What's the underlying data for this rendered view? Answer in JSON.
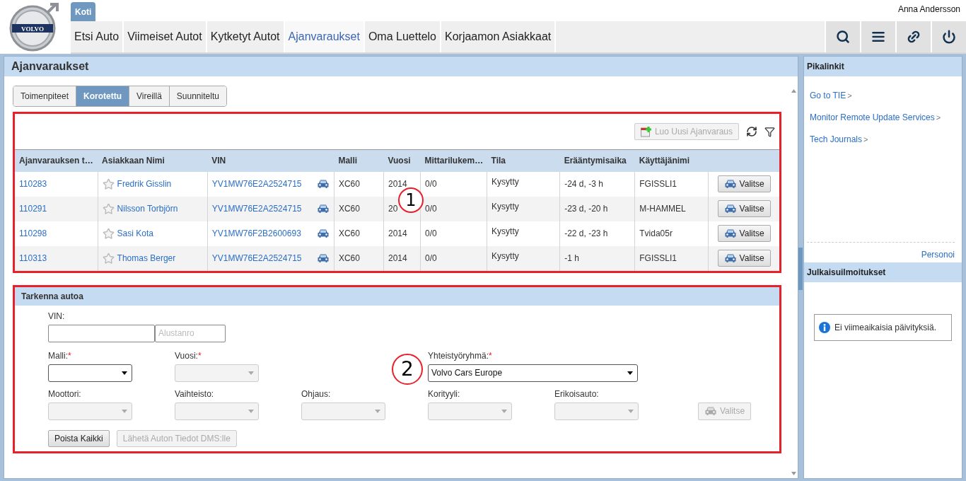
{
  "header": {
    "logo": "VOLVO",
    "home_tab": {
      "label": "Koti",
      "selected": true
    },
    "user": "Anna Andersson",
    "nav": [
      {
        "label": "Etsi Auto",
        "selected": false
      },
      {
        "label": "Viimeiset Autot",
        "selected": false
      },
      {
        "label": "Kytketyt Autot",
        "selected": false
      },
      {
        "label": "Ajanvaraukset",
        "selected": true
      },
      {
        "label": "Oma Luettelo",
        "selected": false
      },
      {
        "label": "Korjaamon Asiakkaat",
        "selected": false
      }
    ]
  },
  "page_title": "Ajanvaraukset",
  "filter_tabs": [
    {
      "label": "Toimenpiteet",
      "selected": false
    },
    {
      "label": "Korotettu",
      "selected": true
    },
    {
      "label": "Vireillä",
      "selected": false
    },
    {
      "label": "Suunniteltu",
      "selected": false
    }
  ],
  "bookings": {
    "callout": "1",
    "new_button": {
      "label": "Luo Uusi Ajanvaraus",
      "disabled": true
    },
    "columns": [
      "Ajanvarauksen t…",
      "Asiakkaan Nimi",
      "VIN",
      "Malli",
      "Vuosi",
      "Mittarilukem…",
      "Tila",
      "Erääntymisaika",
      "Käyttäjänimi"
    ],
    "rows": [
      {
        "id": "110283",
        "favorite": false,
        "name": "Fredrik Gisslin",
        "vin": "YV1MW76E2A2524715",
        "model": "XC60",
        "year": "2014",
        "mileage": "0/0",
        "status": "Kysytty",
        "due": "-24 d, -3 h",
        "user": "FGISSLI1",
        "action": "Valitse"
      },
      {
        "id": "110291",
        "favorite": false,
        "name": "Nilsson Torbjörn",
        "vin": "YV1MW76E2A2524715",
        "model": "XC60",
        "year": "20",
        "mileage": "0/0",
        "status": "Kysytty",
        "due": "-23 d, -20 h",
        "user": "M-HAMMEL",
        "action": "Valitse"
      },
      {
        "id": "110298",
        "favorite": false,
        "name": "Sasi Kota",
        "vin": "YV1MW76F2B2600693",
        "model": "XC60",
        "year": "2014",
        "mileage": "0/0",
        "status": "Kysytty",
        "due": "-22 d, -23 h",
        "user": "Tvida05r",
        "action": "Valitse"
      },
      {
        "id": "110313",
        "favorite": false,
        "name": "Thomas Berger",
        "vin": "YV1MW76E2A2524715",
        "model": "XC60",
        "year": "2014",
        "mileage": "0/0",
        "status": "Kysytty",
        "due": "-1 h",
        "user": "FGISSLI1",
        "action": "Valitse"
      }
    ]
  },
  "refine": {
    "callout": "2",
    "title": "Tarkenna autoa",
    "vin_label": "VIN:",
    "chassis_placeholder": "Alustanro",
    "fields": [
      {
        "label": "Malli:",
        "required_mark": "*",
        "disabled": false
      },
      {
        "label": "Vuosi:",
        "required_mark": "*",
        "disabled": true
      },
      {
        "kind": "spacer"
      },
      {
        "label": "Yhteistyöryhmä:",
        "required_mark": "*",
        "disabled": false,
        "value": "Volvo Cars Europe",
        "kind": "wide"
      },
      {
        "label": "Moottori:",
        "disabled": true
      },
      {
        "label": "Vaihteisto:",
        "disabled": true
      },
      {
        "label": "Ohjaus:",
        "disabled": true
      },
      {
        "label": "Korityyli:",
        "disabled": true
      },
      {
        "label": "Erikoisauto:",
        "disabled": true
      }
    ],
    "select_button": {
      "label": "Valitse",
      "disabled": true
    },
    "buttons": [
      {
        "label": "Poista Kaikki",
        "disabled": false
      },
      {
        "label": "Lähetä Auton Tiedot DMS:lle",
        "disabled": true
      }
    ]
  },
  "sidebar": {
    "title": "Pikalinkit",
    "links": [
      {
        "label": "Go to TIE",
        "arrow": ">"
      },
      {
        "label": "Monitor Remote Update Services",
        "arrow": ">"
      },
      {
        "label": "Tech Journals",
        "arrow": ">"
      }
    ],
    "personalize": "Personoi",
    "notices_title": "Julkaisuilmoitukset",
    "notice": "Ei viimeaikaisia päivityksiä."
  }
}
